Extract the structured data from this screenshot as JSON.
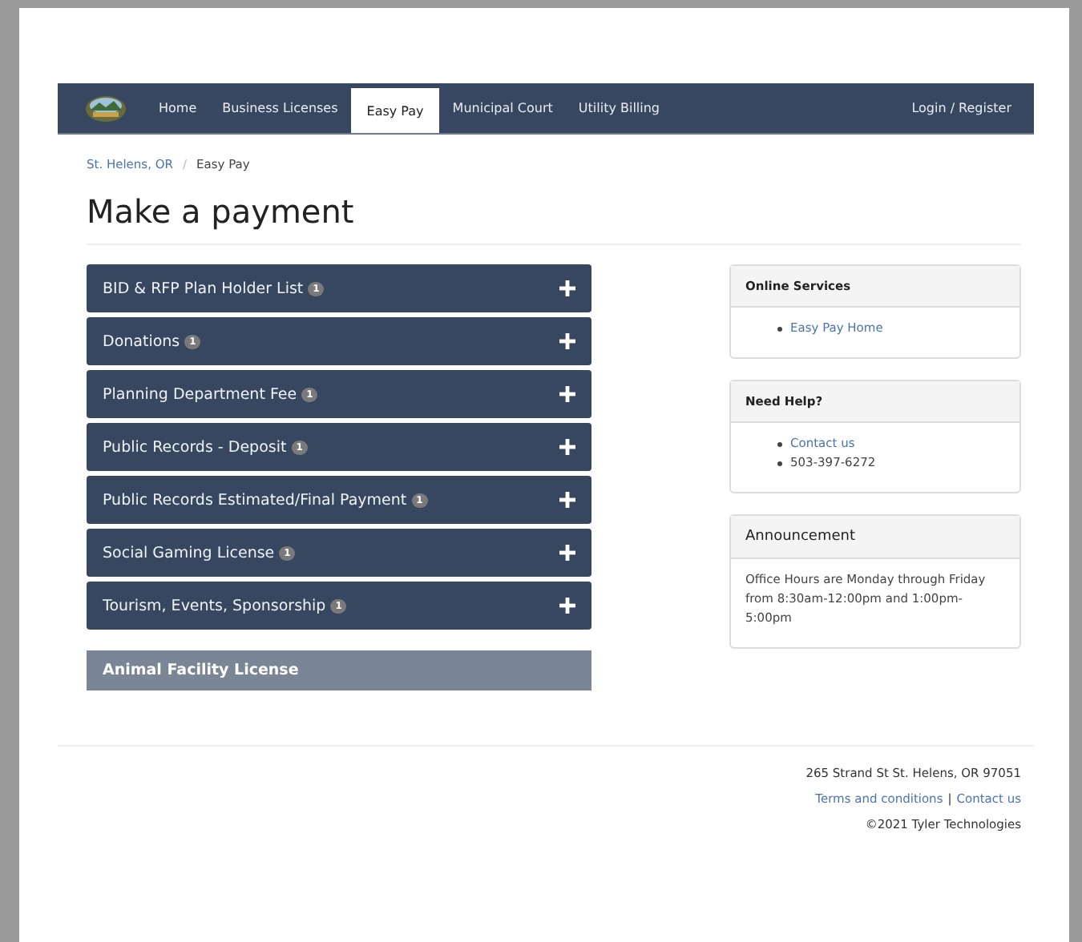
{
  "nav": {
    "items": [
      {
        "label": "Home",
        "selected": false
      },
      {
        "label": "Business Licenses",
        "selected": false
      },
      {
        "label": "Easy Pay",
        "selected": true
      },
      {
        "label": "Municipal Court",
        "selected": false
      },
      {
        "label": "Utility Billing",
        "selected": false
      }
    ],
    "login": "Login / Register"
  },
  "breadcrumb_separator": "/",
  "breadcrumb": [
    {
      "label": "St. Helens, OR",
      "kind": "link"
    },
    {
      "label": "Easy Pay",
      "kind": "current"
    }
  ],
  "title": "Make a payment",
  "payments": [
    {
      "kind": "item",
      "label": "BID & RFP Plan Holder List",
      "count": "1",
      "expanded": false
    },
    {
      "kind": "item",
      "label": "Donations",
      "count": "1",
      "expanded": false
    },
    {
      "kind": "item",
      "label": "Planning Department Fee",
      "count": "1",
      "expanded": false
    },
    {
      "kind": "item",
      "label": "Public Records - Deposit",
      "count": "1",
      "expanded": false
    },
    {
      "kind": "item",
      "label": "Public Records Estimated/Final Payment",
      "count": "1",
      "expanded": false
    },
    {
      "kind": "item",
      "label": "Social Gaming License",
      "count": "1",
      "expanded": false
    },
    {
      "kind": "item",
      "label": "Tourism, Events, Sponsorship",
      "count": "1",
      "expanded": false
    },
    {
      "kind": "group",
      "label": "Animal Facility License"
    }
  ],
  "panels": [
    {
      "kind": "list",
      "heading": "Online Services",
      "items": [
        {
          "text": "Easy Pay Home",
          "kind": "link"
        }
      ]
    },
    {
      "kind": "list",
      "heading": "Need Help?",
      "items": [
        {
          "text": "Contact us",
          "kind": "link"
        },
        {
          "text": "503-397-6272",
          "kind": "text"
        }
      ]
    },
    {
      "kind": "text",
      "heading": "Announcement",
      "text": "Office Hours are Monday through Friday from 8:30am-12:00pm and 1:00pm-5:00pm"
    }
  ],
  "footer": {
    "address": "265 Strand St St. Helens, OR 97051",
    "links": [
      "Terms and conditions",
      "Contact us"
    ],
    "separator": "|",
    "copyright": "©2021 Tyler Technologies"
  }
}
